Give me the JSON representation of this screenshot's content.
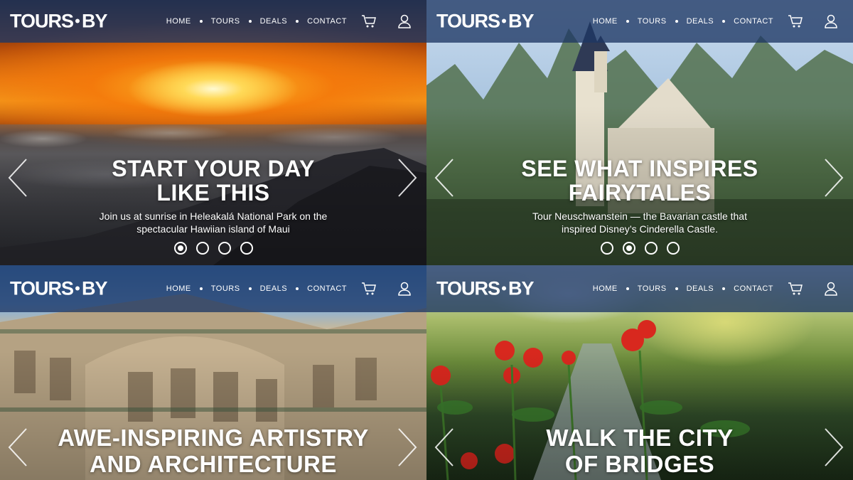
{
  "brand": {
    "logo_left": "TOURS",
    "logo_right": "BY"
  },
  "nav": {
    "home": "HOME",
    "tours": "TOURS",
    "deals": "DEALS",
    "contact": "CONTACT"
  },
  "icons": {
    "cart": "cart-icon",
    "user": "user-icon",
    "prev": "chevron-left-icon",
    "next": "chevron-right-icon"
  },
  "colors": {
    "nav_bg": "#1e3764",
    "text": "#ffffff"
  },
  "slides": [
    {
      "headline_1": "START YOUR DAY",
      "headline_2": "LIKE THIS",
      "sub_1": "Join us at sunrise in Heleakalá National Park on the",
      "sub_2": "spectacular Hawiian island of Maui",
      "active_dot": 1
    },
    {
      "headline_1": "SEE WHAT INSPIRES",
      "headline_2": "FAIRYTALES",
      "sub_1": "Tour Neuschwanstein — the Bavarian castle that",
      "sub_2": "inspired Disney’s Cinderella Castle.",
      "active_dot": 2
    },
    {
      "headline_1": "AWE-INSPIRING ARTISTRY",
      "headline_2": "AND ARCHITECTURE"
    },
    {
      "headline_1": "WALK THE CITY",
      "headline_2": "OF BRIDGES"
    }
  ]
}
